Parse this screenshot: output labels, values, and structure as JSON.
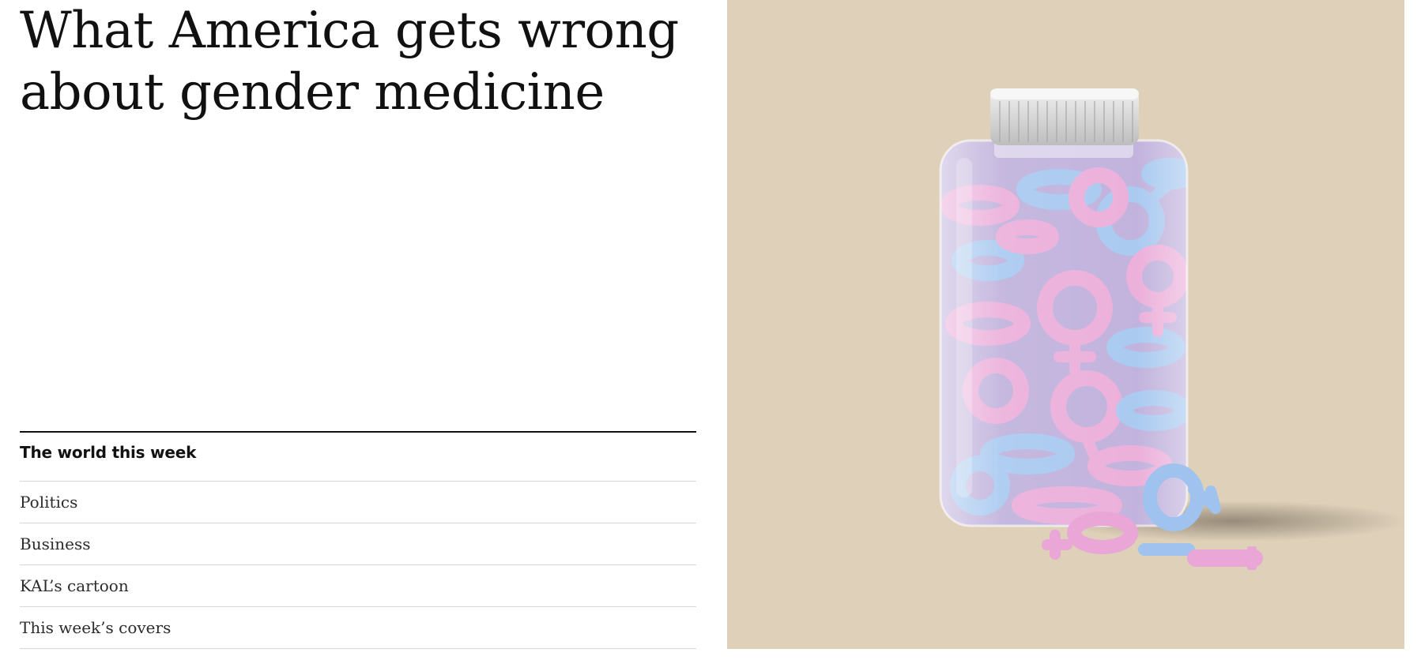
{
  "article": {
    "headline": "What America gets wrong about gender medicine"
  },
  "section": {
    "title": "The world this week",
    "items": [
      {
        "label": "Politics"
      },
      {
        "label": "Business"
      },
      {
        "label": "KAL’s cartoon"
      },
      {
        "label": "This week’s covers"
      }
    ]
  },
  "colors": {
    "image_background": "#ded0b9",
    "pink_symbol": "#e9a6d6",
    "blue_symbol": "#9fc3ee",
    "cap": "#d3d3d3"
  },
  "icons": {
    "hero": "pill-bottle-with-gender-symbols"
  }
}
